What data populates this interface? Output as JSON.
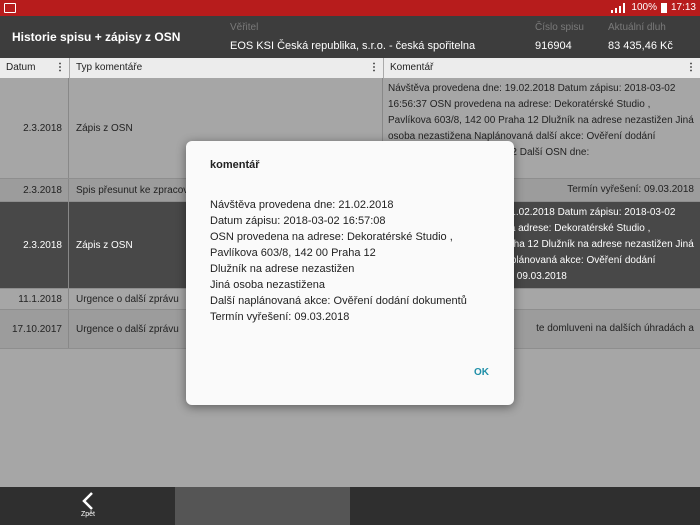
{
  "status_bar": {
    "battery": "100%",
    "time": "17:13"
  },
  "header": {
    "title": "Historie spisu + zápisy z OSN",
    "creditor_label": "Věřitel",
    "creditor_value": "EOS KSI Česká republika, s.r.o. - česká spořitelna",
    "file_label": "Číslo spisu",
    "file_value": "916904",
    "debt_label": "Aktuální dluh",
    "debt_value": "83 435,46 Kč"
  },
  "table": {
    "columns": [
      "Datum",
      "Typ komentáře",
      "Komentář"
    ],
    "rows": [
      {
        "date": "2.3.2018",
        "type": "Zápis z OSN",
        "comment": "Návštěva provedena dne: 19.02.2018 Datum zápisu: 2018-03-02 16:56:37 OSN provedena na adrese: Dekoratérské Studio , Pavlíkova 603/8, 142 00 Praha 12 Dlužník na adrese nezastižen Jiná osoba nezastižena Naplánovaná další akce: Ověření dodání dokumentů, 142 00 Praha 12 Další OSN dne:"
      },
      {
        "date": "2.3.2018",
        "type": "Spis přesunut ke zpracování",
        "comment": "Termín vyřešení: 09.03.2018"
      },
      {
        "date": "2.3.2018",
        "type": "Zápis z OSN",
        "comment": "Návštěva provedena dne: 21.02.2018 Datum zápisu: 2018-03-02 16:57:08 OSN provedena na adrese: Dekoratérské Studio , Pavlíkova 603/8, 142 00 Praha 12 Dlužník na adrese nezastižen Jiná osoba nezastižena Další naplánovaná akce: Ověření dodání dokumentů Termín vyřešení: 09.03.2018"
      },
      {
        "date": "11.1.2018",
        "type": "Urgence o další zprávu",
        "comment": ""
      },
      {
        "date": "17.10.2017",
        "type": "Urgence o další zprávu",
        "comment": "te domluveni na dalších úhradách a"
      }
    ]
  },
  "bottom_bar": {
    "back_label": "Zpět"
  },
  "dialog": {
    "title": "komentář",
    "lines": [
      "Návštěva provedena dne: 21.02.2018",
      "Datum zápisu: 2018-03-02 16:57:08",
      "OSN provedena na adrese:  Dekoratérské Studio ,",
      "Pavlíkova 603/8, 142 00 Praha 12",
      "Dlužník na adrese nezastižen",
      "Jiná osoba nezastižena",
      "Další naplánovaná akce: Ověření dodání dokumentů",
      "Termín vyřešení:  09.03.2018"
    ],
    "ok_label": "OK"
  },
  "colors": {
    "status_bar": "#b71c1c",
    "header": "#3d3d3d",
    "accent": "#1f8fa8"
  }
}
